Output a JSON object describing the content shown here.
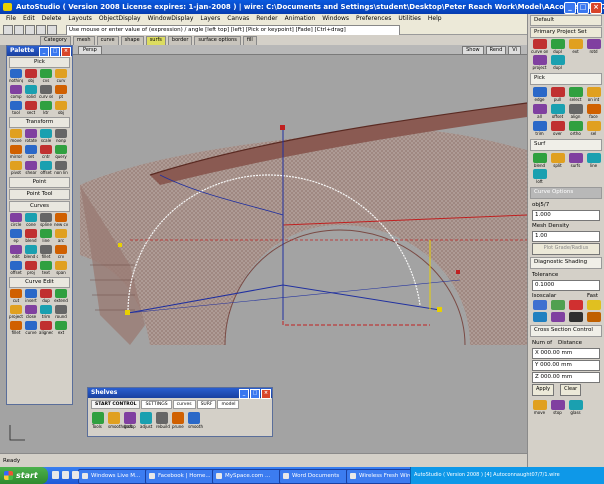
{
  "app": {
    "title": "AutoStudio ( Version 2008 License expires: 1-jan-2008 ) | wire: C:\\Documents and Settings\\student\\Desktop\\Peter Reach Work\\Model\\AAconnaught07/7/1.wire"
  },
  "menu": [
    "File",
    "Edit",
    "Delete",
    "Layouts",
    "ObjectDisplay",
    "WindowDisplay",
    "Layers",
    "Canvas",
    "Render",
    "Animation",
    "Windows",
    "Preferences",
    "Utilities",
    "Help"
  ],
  "prompt": {
    "text": "Use mouse or enter value of (expression) / angle [left top] [left] [Pick or keypoint] [Fade] [Ctrl+drag]"
  },
  "shelf_tabs": [
    {
      "label": "Category",
      "active": false
    },
    {
      "label": "mesh",
      "active": false
    },
    {
      "label": "curve",
      "active": false
    },
    {
      "label": "shape",
      "active": false
    },
    {
      "label": "surfs",
      "active": true
    },
    {
      "label": "border",
      "active": false
    },
    {
      "label": "surface options",
      "active": false
    },
    {
      "label": "fill",
      "active": false
    }
  ],
  "viewport": {
    "label": "Persp",
    "buttons": [
      "Show",
      "Rend",
      "Vi"
    ]
  },
  "palette": {
    "title": "Palette",
    "sections": [
      {
        "name": "Pick",
        "tools": [
          "nothing",
          "obj",
          "cvs",
          "curv",
          "comp",
          "solid",
          "curv sect",
          "pt",
          "tool",
          "sect",
          "ktr",
          "obj"
        ]
      },
      {
        "name": "Transform",
        "tools": [
          "move",
          "rotate",
          "scale",
          "nonp",
          "mirror",
          "set",
          "cntr",
          "query",
          "pivot",
          "shear",
          "offset",
          "non lin"
        ]
      },
      {
        "name": "Point",
        "tools": []
      },
      {
        "name": "Point Tool",
        "tools": []
      },
      {
        "name": "Curves",
        "tools": [
          "circle",
          "cone",
          "spline",
          "new cv",
          "ep",
          "blend",
          "line",
          "arc",
          "edit",
          "blend crv",
          "fillet",
          "crv",
          "offset",
          "proj",
          "text",
          "span"
        ]
      },
      {
        "name": "Curve Edit",
        "tools": [
          "cut",
          "insert",
          "dup",
          "extend",
          "project",
          "close",
          "trim",
          "round",
          "fillet",
          "curve",
          "aligned",
          "ext"
        ]
      }
    ]
  },
  "shelves": {
    "title": "Shelves",
    "tabs": [
      {
        "label": "START CONTROL",
        "active": true
      },
      {
        "label": "SETTINGS",
        "active": false
      },
      {
        "label": "curves",
        "active": false
      },
      {
        "label": "SURF",
        "active": false
      },
      {
        "label": "model",
        "active": false
      }
    ],
    "items": [
      "Tools",
      "smoothdraft",
      "group",
      "adjust",
      "rebuild",
      "prune",
      "smooth"
    ]
  },
  "rpanel": {
    "header": "Default",
    "head2": "Primary Project Set",
    "top_tools": [
      "curve on surf",
      "dupl",
      "ext",
      "rotd"
    ],
    "top_tools2": [
      "project",
      "dupl"
    ],
    "sec1": "Pick",
    "tools_a": [
      "edge",
      "pull",
      "select",
      "on int",
      "all",
      "offset",
      "align",
      "face",
      "trim",
      "over",
      "ortho",
      "sel"
    ],
    "sec2": "Surf",
    "tools_b": [
      "blend",
      "split",
      "surfs",
      "line"
    ],
    "tools_c": [
      "loft"
    ],
    "fields": {
      "control_label": "Curve Options",
      "sub": "obj­5/7",
      "val1": "1.000",
      "dens_label": "Mesh Density",
      "val2": "1.00",
      "grade_btn": "Plot Grade/Radius"
    },
    "diag": "Diagnostic Shading",
    "tolerance_label": "Tolerance",
    "tolerance_val": "0.1000",
    "modes": [
      "Isoscalar",
      "Fast"
    ],
    "cross": "Cross Section Control",
    "cross_rows": [
      "Num of",
      "Distance"
    ],
    "cross_vals": [
      "X 000.00 mm",
      "Y 000.00 mm",
      "Z 000.00 mm"
    ],
    "apply": "Apply",
    "clear": "Clear",
    "bottom_icons": [
      "move",
      "stop",
      "glass"
    ]
  },
  "status": {
    "text": "Ready"
  },
  "taskbar": {
    "start": "start",
    "tasks": [
      "Windows Live M...",
      "Facebook | Home...",
      "MySpace.com ...",
      "Word Documents",
      "Wireless Fresh Wire..."
    ],
    "tray": "AutoStudio ( Version 2008 ) [4] Autoconnaught07/7/1.wire"
  }
}
